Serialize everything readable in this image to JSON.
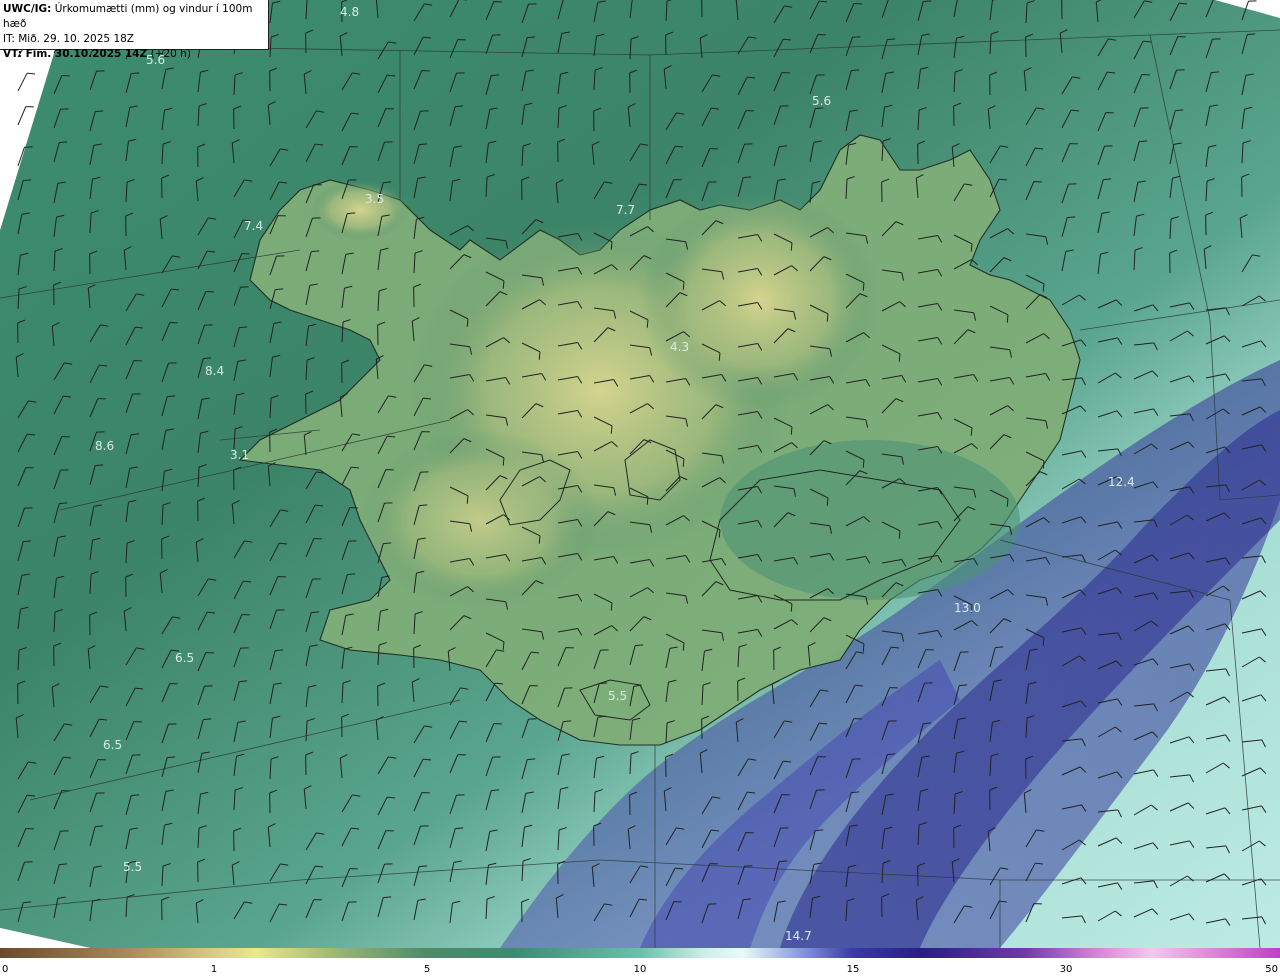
{
  "header": {
    "title_bold": "UWC/IG:",
    "title_rest": " Úrkomumætti (mm) og vindur í 100m hæð",
    "issue_time": "IT: Mið. 29. 10. 2025 18Z",
    "valid_bold": "VT: Fim. 30.10.2025 14Z",
    "valid_rest": " (+20 h)"
  },
  "value_labels": [
    "4.8",
    "5.6",
    "5.6",
    "3.5",
    "7.4",
    "7.7",
    "8.4",
    "4.3",
    "8.6",
    "3.1",
    "12.4",
    "13.0",
    "6.5",
    "5.5",
    "6.5",
    "5.5",
    "14.7"
  ],
  "colorbar": {
    "ticks": [
      "0",
      "1",
      "5",
      "10",
      "15",
      "30",
      "50"
    ],
    "colors": [
      "#6b4a2a",
      "#e9e88e",
      "#3e8a70",
      "#e9fbf7",
      "#2a1d86",
      "#d98ad8",
      "#c040c0"
    ]
  },
  "colors": {
    "sea_low": "#3f8a6e",
    "sea_high": "#cdeee8",
    "land": "#cfd28a",
    "heavy": "#2f2f9a"
  }
}
